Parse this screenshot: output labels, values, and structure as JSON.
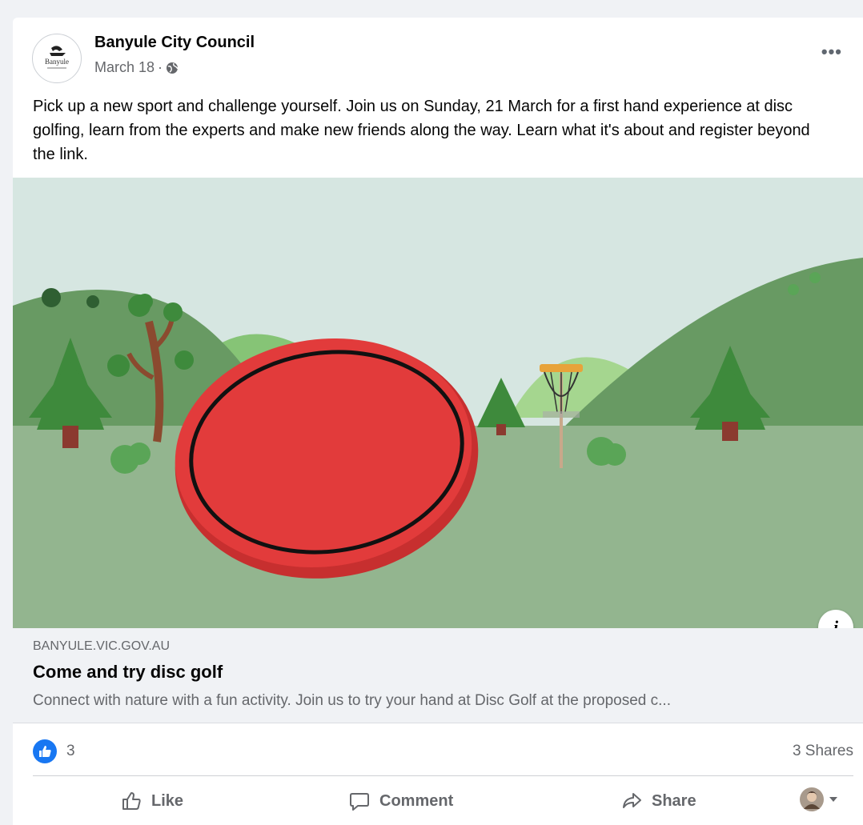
{
  "post": {
    "page_name": "Banyule City Council",
    "avatar_text": "Banyule",
    "date": "March 18",
    "separator": "·",
    "privacy_icon": "globe-icon",
    "more_label": "•••",
    "text": "Pick up a new sport and challenge yourself. Join us on Sunday, 21 March for a first hand experience at disc golfing, learn from the experts and make new friends along the way. Learn what it's about and register beyond the link."
  },
  "media": {
    "info_label": "i",
    "colors": {
      "sky": "#d6e6e1",
      "ground": "#93b58f",
      "hill_dark": "#689a63",
      "hill_light": "#86c476",
      "disc": "#e23b3b",
      "disc_edge": "#c72f2f",
      "tree": "#3e8a3c",
      "trunk": "#8b3a2f"
    }
  },
  "link": {
    "domain": "BANYULE.VIC.GOV.AU",
    "title": "Come and try disc golf",
    "description": "Connect with nature with a fun activity. Join us to try your hand at Disc Golf at the proposed c..."
  },
  "stats": {
    "like_count": "3",
    "shares": "3 Shares"
  },
  "actions": {
    "like": "Like",
    "comment": "Comment",
    "share": "Share"
  }
}
